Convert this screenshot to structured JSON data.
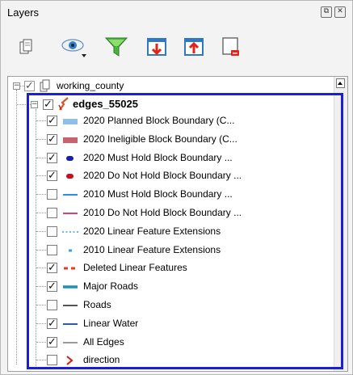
{
  "panel": {
    "title": "Layers",
    "float_button": "⧉",
    "close_button": "✕"
  },
  "toolbar": {
    "buttons": [
      {
        "icon": "open-layer-styling-icon"
      },
      {
        "icon": "manage-map-themes-icon"
      },
      {
        "icon": "filter-legend-icon"
      },
      {
        "icon": "expand-all-icon"
      },
      {
        "icon": "collapse-all-icon"
      },
      {
        "icon": "remove-layer-icon"
      }
    ]
  },
  "tree": {
    "group": {
      "label": "working_county",
      "checked": true,
      "expanded": true
    },
    "layer": {
      "label": "edges_55025",
      "checked": true,
      "expanded": true
    },
    "items": [
      {
        "label": "2020 Planned Block Boundary   (C...",
        "checked": true,
        "symbol": "rect",
        "color": "#8fbfe9"
      },
      {
        "label": "2020 Ineligible Block Boundary  (C...",
        "checked": true,
        "symbol": "rect",
        "color": "#c8626e"
      },
      {
        "label": "2020 Must Hold Block Boundary   ...",
        "checked": true,
        "symbol": "dash",
        "color": "#1420b4"
      },
      {
        "label": "2020 Do Not Hold Block Boundary ...",
        "checked": true,
        "symbol": "dash",
        "color": "#c8101c"
      },
      {
        "label": "2010 Must Hold Block Boundary   ...",
        "checked": false,
        "symbol": "line",
        "color": "#2b8fe0"
      },
      {
        "label": "2010 Do Not Hold Block Boundary ...",
        "checked": false,
        "symbol": "line",
        "color": "#d8407a"
      },
      {
        "label": "2020 Linear Feature Extensions",
        "checked": false,
        "symbol": "dots",
        "color": "#3aa2e6"
      },
      {
        "label": "2010 Linear Feature Extensions",
        "checked": false,
        "symbol": "dot",
        "color": "#3aa2e6"
      },
      {
        "label": "Deleted Linear Features",
        "checked": true,
        "symbol": "dashes",
        "color": "#e8382a"
      },
      {
        "label": "Major Roads",
        "checked": true,
        "symbol": "thick",
        "color": "#1f8fb8"
      },
      {
        "label": "Roads",
        "checked": false,
        "symbol": "line",
        "color": "#555555"
      },
      {
        "label": "Linear Water",
        "checked": true,
        "symbol": "line",
        "color": "#2d5fa8"
      },
      {
        "label": "All Edges",
        "checked": true,
        "symbol": "line",
        "color": "#9a9a9a"
      },
      {
        "label": "direction",
        "checked": false,
        "symbol": "chevron",
        "color": "#d81818"
      }
    ]
  },
  "colors": {
    "selection_outline": "#1b1fd4"
  }
}
